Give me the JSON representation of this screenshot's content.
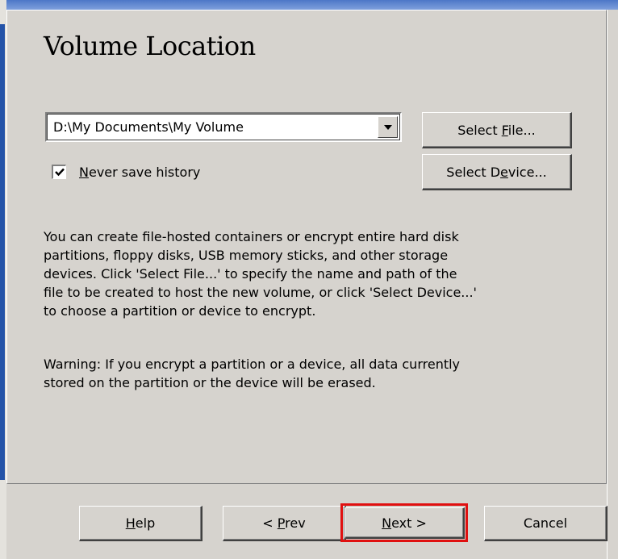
{
  "page": {
    "title": "Volume Location"
  },
  "location": {
    "value": "D:\\My Documents\\My Volume"
  },
  "buttons": {
    "select_file_pre": "Select ",
    "select_file_key": "F",
    "select_file_post": "ile...",
    "select_device_pre": "Select D",
    "select_device_key": "e",
    "select_device_post": "vice...",
    "help_key": "H",
    "help_post": "elp",
    "prev_pre": "< ",
    "prev_key": "P",
    "prev_post": "rev",
    "next_key": "N",
    "next_post": "ext >",
    "cancel": "Cancel"
  },
  "history": {
    "checked": true,
    "label_key": "N",
    "label_post": "ever save history"
  },
  "info": {
    "description": "You can create file-hosted containers or encrypt entire hard disk\npartitions, floppy disks, USB memory sticks, and other storage\ndevices. Click 'Select File...' to specify the name and path of the\nfile to be created to host the new volume, or click 'Select Device...'\nto choose a partition or device to encrypt.",
    "warning": "Warning: If you encrypt a partition or a device, all data currently\nstored on the partition or the device will be erased."
  },
  "colors": {
    "face": "#d6d3ce",
    "highlight_box": "#e01010",
    "accent_blue": "#2453a8"
  },
  "icons": {
    "dropdown": "triangle-down",
    "check": "checkmark"
  }
}
